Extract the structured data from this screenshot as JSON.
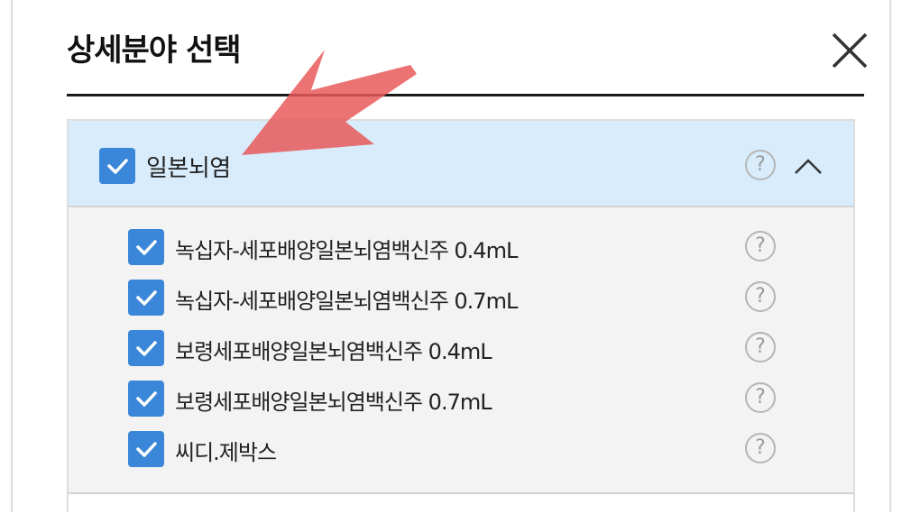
{
  "dialog": {
    "title": "상세분야 선택",
    "close_icon": "close-icon"
  },
  "group": {
    "label": "일본뇌염",
    "checked": true,
    "help_icon": "question-circle-icon",
    "help_glyph": "?",
    "toggle_icon": "chevron-up-icon",
    "expanded": true
  },
  "items": [
    {
      "label": "녹십자-세포배양일본뇌염백신주 0.4mL",
      "checked": true,
      "help_glyph": "?"
    },
    {
      "label": "녹십자-세포배양일본뇌염백신주 0.7mL",
      "checked": true,
      "help_glyph": "?"
    },
    {
      "label": "보령세포배양일본뇌염백신주 0.4mL",
      "checked": true,
      "help_glyph": "?"
    },
    {
      "label": "보령세포배양일본뇌염백신주 0.7mL",
      "checked": true,
      "help_glyph": "?"
    },
    {
      "label": "씨디.제박스",
      "checked": true,
      "help_glyph": "?"
    }
  ],
  "colors": {
    "checkbox": "#3a86d8",
    "group_header_bg": "#d8ecfb",
    "panel_bg": "#f3f3f3",
    "annotation_arrow": "#e85a5a"
  }
}
